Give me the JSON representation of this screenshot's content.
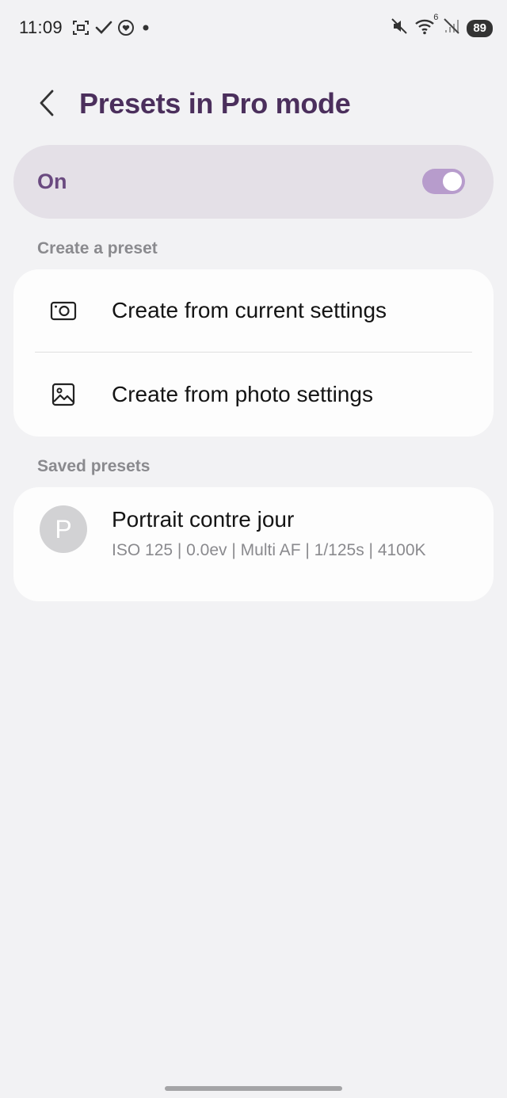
{
  "status_bar": {
    "time": "11:09",
    "left_icons": [
      "screen-capture-icon",
      "checkmark-icon",
      "heart-badge-icon",
      "dot-icon"
    ],
    "right_icons": [
      "mute-icon",
      "wifi-icon",
      "no-signal-icon"
    ],
    "wifi_badge": "6",
    "battery": "89"
  },
  "header": {
    "title": "Presets in Pro mode",
    "back_icon": "chevron-left-icon"
  },
  "master_switch": {
    "label": "On",
    "state": true
  },
  "create_section": {
    "title": "Create a preset",
    "items": [
      {
        "label": "Create from current settings",
        "icon": "camera-icon"
      },
      {
        "label": "Create from photo settings",
        "icon": "image-icon"
      }
    ]
  },
  "saved_section": {
    "title": "Saved presets",
    "presets": [
      {
        "initial": "P",
        "name": "Portrait contre jour",
        "details": "ISO 125 | 0.0ev | Multi AF | 1/125s | 4100K"
      }
    ]
  },
  "colors": {
    "accent": "#4b2f5c",
    "toggle_on": "#b79ccc",
    "background": "#f2f2f4"
  }
}
